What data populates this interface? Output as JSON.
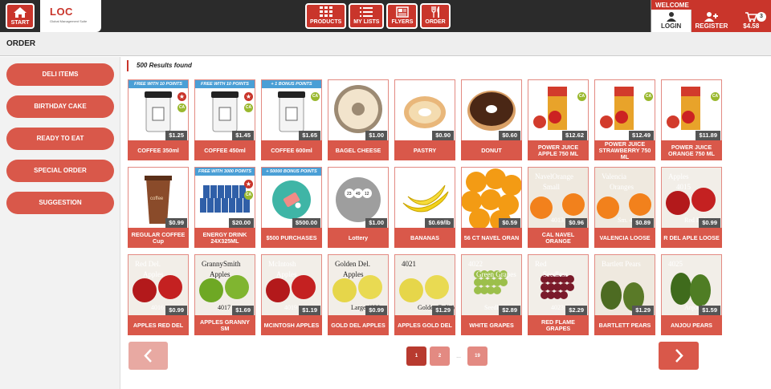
{
  "header": {
    "start_label": "START",
    "logo_text": "LOC",
    "logo_tagline": "Global Management Suite",
    "nav": [
      {
        "label": "PRODUCTS",
        "icon": "grid-icon"
      },
      {
        "label": "MY LISTS",
        "icon": "list-icon"
      },
      {
        "label": "FLYERS",
        "icon": "newspaper-icon"
      },
      {
        "label": "ORDER",
        "icon": "cutlery-icon"
      }
    ],
    "welcome": "WELCOME",
    "login_label": "LOGIN",
    "register_label": "REGISTER",
    "cart_total": "$4.58",
    "cart_count": "3"
  },
  "page_title": "ORDER",
  "sidebar": {
    "items": [
      {
        "label": "DELI ITEMS"
      },
      {
        "label": "BIRTHDAY CAKE"
      },
      {
        "label": "READY TO EAT"
      },
      {
        "label": "SPECIAL ORDER"
      },
      {
        "label": "SUGGESTION"
      }
    ]
  },
  "results_text": "500 Results found",
  "products": [
    {
      "name": "COFFEE 350ml",
      "price": "$1.25",
      "promo": "FREE WITH 10 POINTS",
      "star": true,
      "ca": true,
      "kind": "cup"
    },
    {
      "name": "COFFEE 450ml",
      "price": "$1.45",
      "promo": "FREE WITH 10 POINTS",
      "star": true,
      "ca": true,
      "kind": "cup"
    },
    {
      "name": "COFFEE 600ml",
      "price": "$1.65",
      "promo": "+ 1 BONUS POINTS",
      "star": false,
      "ca": true,
      "kind": "cup"
    },
    {
      "name": "BAGEL CHEESE",
      "price": "$1.00",
      "promo": "",
      "star": false,
      "ca": false,
      "kind": "bagel"
    },
    {
      "name": "PASTRY",
      "price": "$0.90",
      "promo": "",
      "star": false,
      "ca": false,
      "kind": "pastry"
    },
    {
      "name": "DONUT",
      "price": "$0.60",
      "promo": "",
      "star": false,
      "ca": false,
      "kind": "donut"
    },
    {
      "name": "POWER JUICE APPLE 750 ML",
      "price": "$12.62",
      "promo": "",
      "star": false,
      "ca": true,
      "kind": "juice"
    },
    {
      "name": "POWER JUICE STRAWBERRY 750 ML",
      "price": "$12.49",
      "promo": "",
      "star": false,
      "ca": true,
      "kind": "juice"
    },
    {
      "name": "POWER JUICE ORANGE 750 ML",
      "price": "$11.89",
      "promo": "",
      "star": false,
      "ca": true,
      "kind": "juice"
    },
    {
      "name": "REGULAR COFFEE Cup",
      "price": "$0.99",
      "promo": "",
      "star": false,
      "ca": false,
      "kind": "papercup"
    },
    {
      "name": "ENERGY DRINK 24X325ML",
      "price": "$20.00",
      "promo": "FREE WITH 3000 POINTS",
      "star": true,
      "ca": true,
      "kind": "cans"
    },
    {
      "name": "$500 PURCHASES",
      "price": "$500.00",
      "promo": "+ 50000 BONUS POINTS",
      "star": false,
      "ca": false,
      "kind": "tag"
    },
    {
      "name": "Lottery",
      "price": "$1.00",
      "promo": "",
      "star": false,
      "ca": false,
      "kind": "lottery"
    },
    {
      "name": "BANANAS",
      "price": "$0.69/lb",
      "promo": "",
      "star": false,
      "ca": false,
      "kind": "banana"
    },
    {
      "name": "56 CT NAVEL ORAN",
      "price": "$0.59",
      "promo": "",
      "star": false,
      "ca": false,
      "kind": "oranges"
    },
    {
      "name": "CAL NAVEL ORANGE",
      "price": "$0.96",
      "promo": "",
      "star": false,
      "ca": false,
      "kind": "orange-sign",
      "sign": [
        "NavelOrange",
        "Small",
        "4013"
      ]
    },
    {
      "name": "VALENCIA LOOSE",
      "price": "$0.89",
      "promo": "",
      "star": false,
      "ca": false,
      "kind": "orange-sign",
      "sign": [
        "Valencia",
        "Oranges",
        "Sm. 4014"
      ]
    },
    {
      "name": "R DEL APLE LOOSE",
      "price": "$0.99",
      "promo": "",
      "star": false,
      "ca": false,
      "kind": "apple-sign-red",
      "sign": [
        "Apples",
        "4015",
        "Red Deli"
      ]
    },
    {
      "name": "APPLES RED DEL",
      "price": "$0.99",
      "promo": "",
      "star": false,
      "ca": false,
      "kind": "apple-sign-red",
      "sign": [
        "Red Del.",
        "Apples",
        "4016"
      ]
    },
    {
      "name": "APPLES GRANNY SM",
      "price": "$1.69",
      "promo": "",
      "star": false,
      "ca": false,
      "kind": "apple-sign-green",
      "sign": [
        "GrannySmith",
        "Apples",
        "4017"
      ]
    },
    {
      "name": "MCINTOSH APPLES",
      "price": "$1.19",
      "promo": "",
      "star": false,
      "ca": false,
      "kind": "apple-sign-red",
      "sign": [
        "McIntosh",
        "Apples",
        "4019"
      ]
    },
    {
      "name": "GOLD DEL APPLES",
      "price": "$0.99",
      "promo": "",
      "star": false,
      "ca": false,
      "kind": "apple-sign-gold",
      "sign": [
        "Golden Del.",
        "Apples",
        "Large 4020"
      ]
    },
    {
      "name": "APPLES GOLD DEL",
      "price": "$1.29",
      "promo": "",
      "star": false,
      "ca": false,
      "kind": "apple-sign-gold",
      "sign": [
        "4021",
        "",
        "Golden Delicious"
      ]
    },
    {
      "name": "WHITE GRAPES",
      "price": "$2.89",
      "promo": "",
      "star": false,
      "ca": false,
      "kind": "grapes-green",
      "sign": [
        "4022",
        "Green Grapes",
        "Seedless"
      ]
    },
    {
      "name": "RED FLAME GRAPES",
      "price": "$2.29",
      "promo": "",
      "star": false,
      "ca": false,
      "kind": "grapes-red",
      "sign": [
        "Red",
        "Seedless",
        "4023"
      ]
    },
    {
      "name": "BARTLETT PEARS",
      "price": "$1.29",
      "promo": "",
      "star": false,
      "ca": false,
      "kind": "pears",
      "sign": [
        "Bartlett Pears",
        "",
        ""
      ]
    },
    {
      "name": "ANJOU PEARS",
      "price": "$1.59",
      "promo": "",
      "star": false,
      "ca": false,
      "kind": "pears-green",
      "sign": [
        "4025",
        "",
        "Anjou Pears"
      ]
    }
  ],
  "pagination": {
    "pages": [
      "1",
      "2",
      "19"
    ],
    "ellipsis": "...",
    "current": "1"
  },
  "colors": {
    "accent": "#c9352b",
    "button": "#d9584a",
    "promo": "#4a9fd6",
    "ca_badge": "#9ab82e"
  }
}
